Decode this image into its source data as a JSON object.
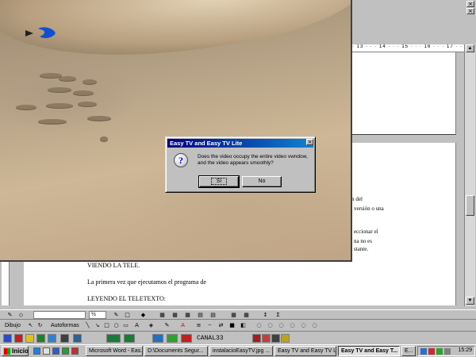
{
  "word": {
    "ruler_text": "· 13 · · · 14 · · · 15 · · · 16 · · · 17 · · ·",
    "doc_left": [
      "VIENDO LA TELE.",
      "La primera vez que ejecutamos el programa de",
      "LEYENDO EL TELETEXTO:"
    ],
    "doc_right": [
      "mación del",
      "versión o una",
      "eccionar el",
      "na no es",
      "stante."
    ]
  },
  "toolbar": {
    "zoom": "½",
    "draw_label": "Dibujo",
    "autoshapes_label": "Autoformas"
  },
  "toolbar3": {
    "channel": "CANAL33"
  },
  "dialog": {
    "title": "Easy TV and Easy TV Lite",
    "message": "Does the video occupy the entire video vwndow, and the video appears smoothly?",
    "yes_label": "Sí",
    "no_label": "No"
  },
  "taskbar": {
    "start_label": "Inicio",
    "tasks": [
      "Microsoft Word - Eas...",
      "D:\\Documents Segur...",
      "instalacioEasyTV.jpg ...",
      "Easy TV and Easy TV Lit...",
      "Easy TV and Easy T...",
      "E..."
    ],
    "clock": "15:29"
  }
}
